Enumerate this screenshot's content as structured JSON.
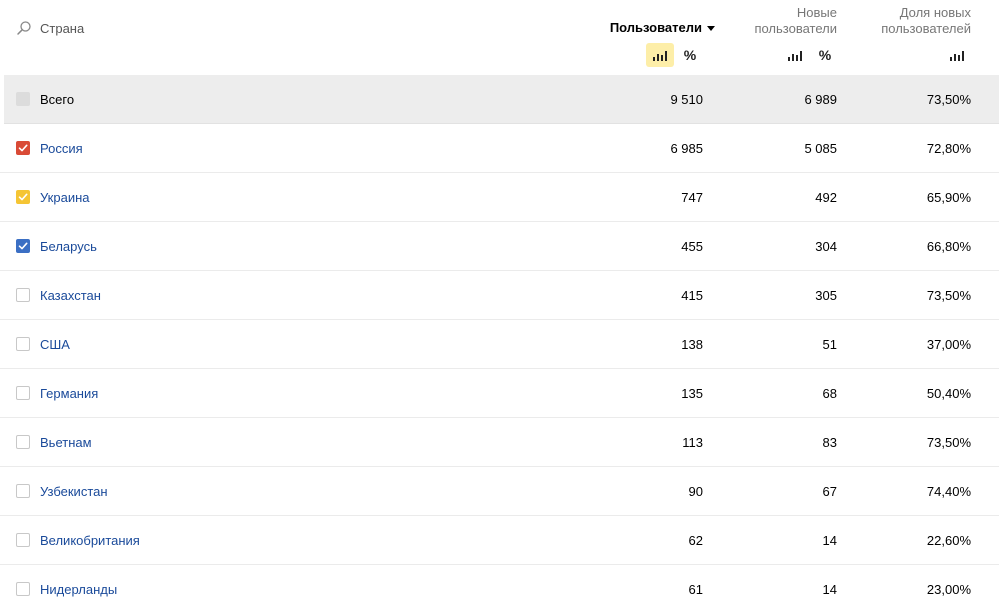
{
  "header": {
    "country_label": "Страна",
    "users_label": "Пользователи",
    "newusers_line1": "Новые",
    "newusers_line2": "пользователи",
    "share_line1": "Доля новых",
    "share_line2": "пользователей",
    "percent_symbol": "%"
  },
  "colors": {
    "link": "#1a4a9a",
    "active_tool": "#fdeea8",
    "total_bg": "#ededed",
    "checked_red": "#d94a36",
    "checked_yellow": "#f5c534",
    "checked_blue": "#3b6fc4"
  },
  "total": {
    "label": "Всего",
    "users": "9 510",
    "newusers": "6 989",
    "share": "73,50%"
  },
  "rows": [
    {
      "label": "Россия",
      "users": "6 985",
      "newusers": "5 085",
      "share": "72,80%",
      "checked": true,
      "color": "#d94a36"
    },
    {
      "label": "Украина",
      "users": "747",
      "newusers": "492",
      "share": "65,90%",
      "checked": true,
      "color": "#f5c534"
    },
    {
      "label": "Беларусь",
      "users": "455",
      "newusers": "304",
      "share": "66,80%",
      "checked": true,
      "color": "#3b6fc4"
    },
    {
      "label": "Казахстан",
      "users": "415",
      "newusers": "305",
      "share": "73,50%",
      "checked": false
    },
    {
      "label": "США",
      "users": "138",
      "newusers": "51",
      "share": "37,00%",
      "checked": false
    },
    {
      "label": "Германия",
      "users": "135",
      "newusers": "68",
      "share": "50,40%",
      "checked": false
    },
    {
      "label": "Вьетнам",
      "users": "113",
      "newusers": "83",
      "share": "73,50%",
      "checked": false
    },
    {
      "label": "Узбекистан",
      "users": "90",
      "newusers": "67",
      "share": "74,40%",
      "checked": false
    },
    {
      "label": "Великобритания",
      "users": "62",
      "newusers": "14",
      "share": "22,60%",
      "checked": false
    },
    {
      "label": "Нидерланды",
      "users": "61",
      "newusers": "14",
      "share": "23,00%",
      "checked": false
    }
  ]
}
